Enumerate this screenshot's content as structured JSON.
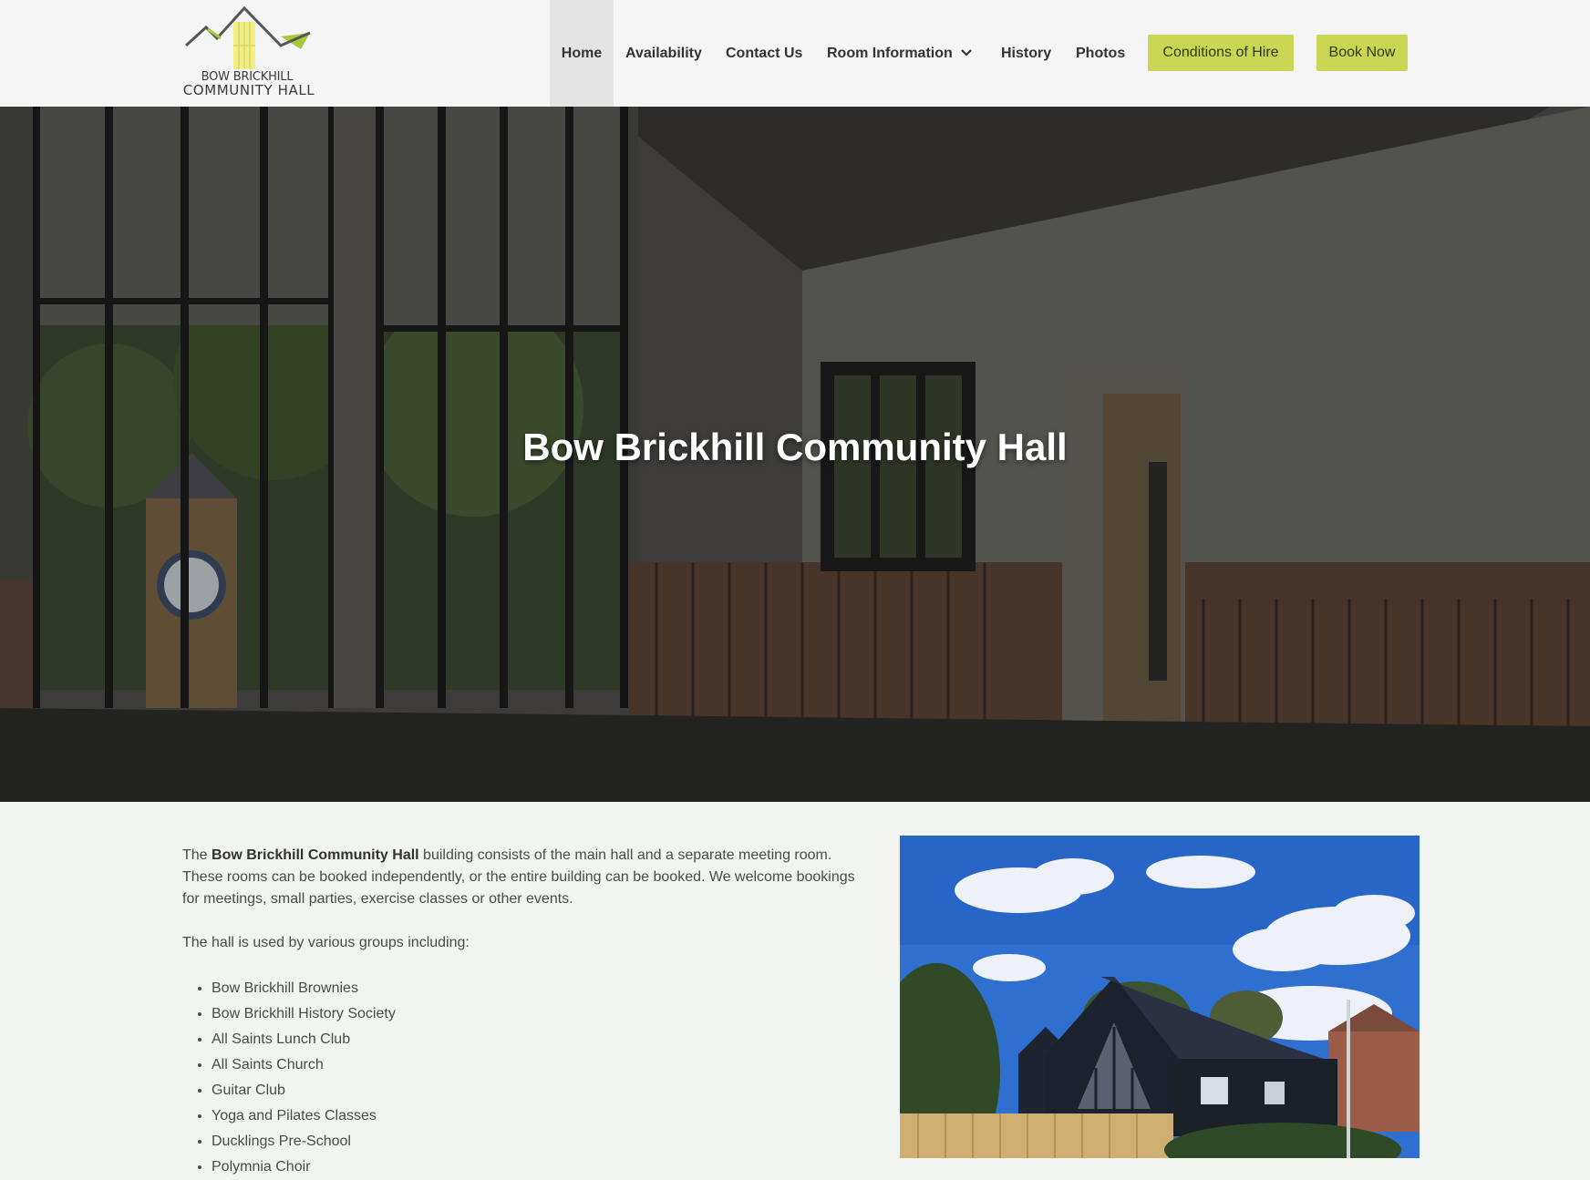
{
  "site": {
    "logo_line1": "BOW BRICKHILL",
    "logo_line2": "COMMUNITY HALL"
  },
  "nav": {
    "items": [
      {
        "label": "Home",
        "active": true
      },
      {
        "label": "Availability"
      },
      {
        "label": "Contact Us"
      },
      {
        "label": "Room Information",
        "icon": "chevron-down-icon"
      },
      {
        "label": "History"
      },
      {
        "label": "Photos"
      }
    ],
    "buttons": [
      {
        "label": "Conditions of Hire"
      },
      {
        "label": "Book Now"
      }
    ]
  },
  "hero": {
    "title": "Bow Brickhill Community Hall"
  },
  "intro": {
    "prefix": "The ",
    "name": "Bow Brickhill Community Hall",
    "text": " building consists of the main hall and a separate meeting room. These rooms can be booked independently, or the entire building can be booked. We welcome bookings for meetings, small parties, exercise classes or other events.",
    "groups_heading": "The hall is used by various groups including:",
    "groups": [
      "Bow Brickhill Brownies",
      "Bow Brickhill History Society",
      "All Saints Lunch Club",
      "All Saints Church",
      "Guitar Club",
      "Yoga and Pilates Classes",
      "Ducklings Pre-School",
      "Polymnia Choir"
    ]
  },
  "colors": {
    "accent": "#c9d653",
    "header_bg": "#f5f5f5",
    "page_bg": "#f1f4ef"
  }
}
